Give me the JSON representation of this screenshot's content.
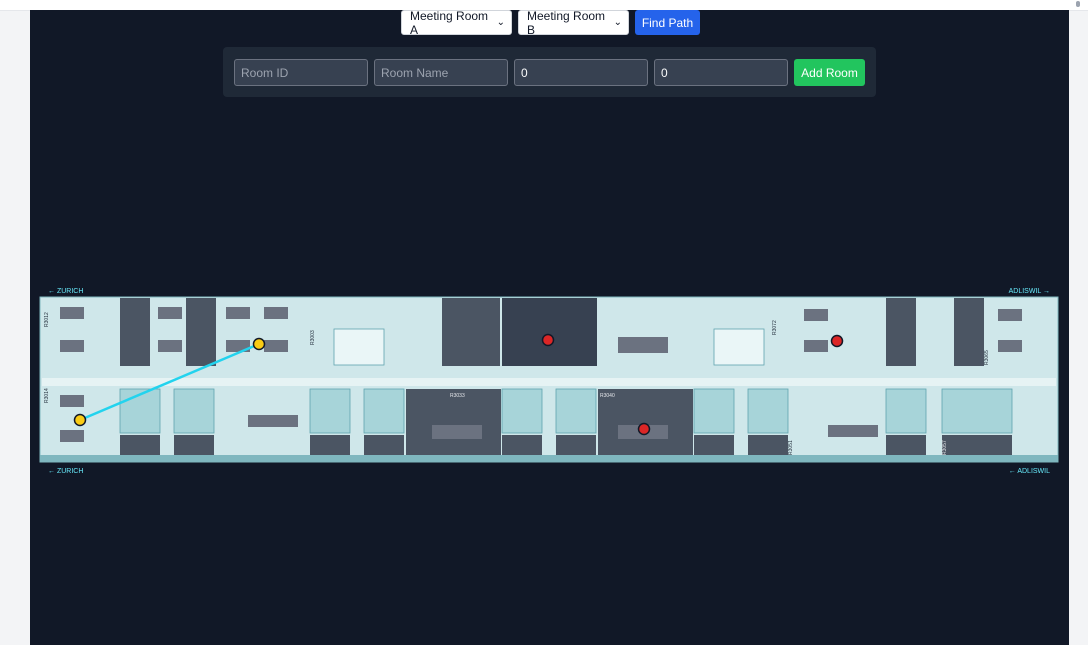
{
  "route": {
    "from": "Meeting Room A",
    "to": "Meeting Room B",
    "find_label": "Find Path"
  },
  "add_room": {
    "room_id_placeholder": "Room ID",
    "room_name_placeholder": "Room Name",
    "x_value": "0",
    "y_value": "0",
    "add_label": "Add Room"
  },
  "floorplan": {
    "direction_top_left": "← ZURICH",
    "direction_top_right": "ADLISWIL →",
    "direction_bottom_left": "← ZURICH",
    "direction_bottom_right": "← ADLISWIL",
    "room_labels": [
      "R3014",
      "R3012",
      "R3003",
      "R3033",
      "R3040",
      "R3072",
      "R3051",
      "R3057",
      "R3065"
    ],
    "path_color": "#22d3ee",
    "endpoint_color": "#facc15",
    "room_marker_color": "#dc2626"
  }
}
